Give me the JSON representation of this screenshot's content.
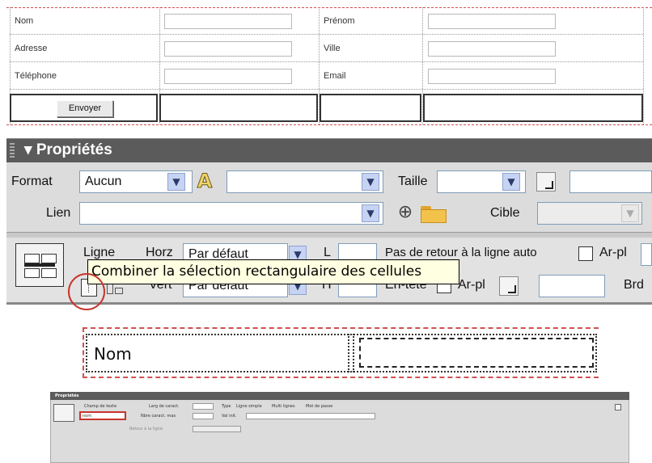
{
  "form": {
    "rows": [
      {
        "label1": "Nom",
        "label2": "Prénom"
      },
      {
        "label1": "Adresse",
        "label2": "Ville"
      },
      {
        "label1": "Téléphone",
        "label2": "Email"
      }
    ],
    "submit_label": "Envoyer"
  },
  "properties": {
    "title": "Propriétés",
    "format_label": "Format",
    "format_value": "Aucun",
    "size_label": "Taille",
    "link_label": "Lien",
    "target_label": "Cible",
    "row_label": "Ligne",
    "horz_label": "Horz",
    "horz_value": "Par défaut",
    "width_label": "L",
    "nowrap_label": "Pas de retour à la ligne auto",
    "bg_label": "Ar-pl",
    "vert_label": "Vert",
    "vert_value": "Par défaut",
    "height_label": "H",
    "header_label": "En-tête",
    "bg_label2": "Ar-pl",
    "border_label": "Brd",
    "tooltip": "Combiner la sélection rectangulaire des cellules"
  },
  "nom_sample": {
    "label": "Nom"
  },
  "mini_panel": {
    "title": "Propriétés",
    "field_name_label": "Champ de texte",
    "field_name_value": "nom",
    "char_width_label": "Larg de caract.",
    "max_chars_label": "Nbre caract. max",
    "type_label": "Type",
    "type_single": "Ligne simple",
    "type_multi": "Multi lignes",
    "type_password": "Mot de passe",
    "init_value_label": "Val init.",
    "wrap_label": "Retour à la ligne"
  },
  "colors": {
    "panel_header": "#5b5b5b",
    "panel_body": "#dcdcdc",
    "tooltip_bg": "#ffffe1",
    "highlight_circle": "#c7332d"
  },
  "icons": [
    "dropdown-arrow-icon",
    "text-style-icon",
    "color-picker-icon",
    "point-to-file-icon",
    "folder-icon",
    "cell-layout-icon",
    "merge-cells-icon",
    "split-cell-icon"
  ]
}
